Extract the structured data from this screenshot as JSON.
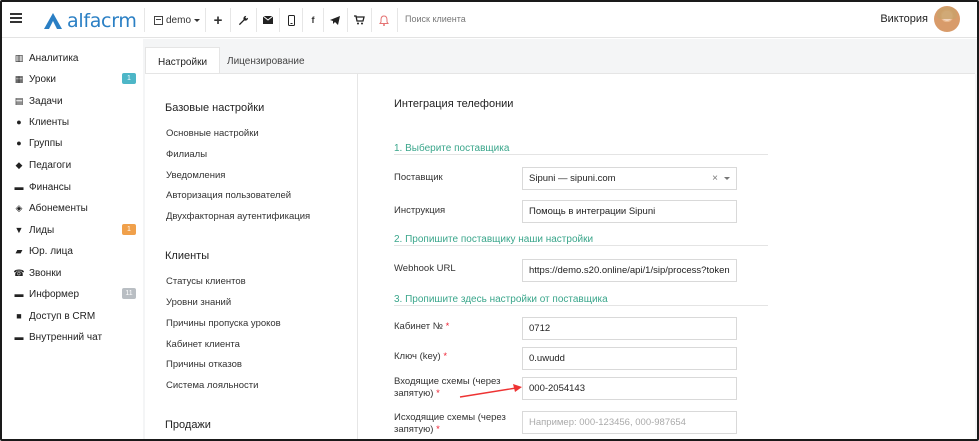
{
  "app": {
    "logo_text": "alfacrm",
    "branch": "demo",
    "search_placeholder": "Поиск клиента",
    "user_name": "Виктория"
  },
  "colors": {
    "accent": "#2a7fc4",
    "green": "#3aa68b",
    "badge_teal": "#4db6c7",
    "badge_orange": "#f0a04b",
    "badge_grey": "#b9bec3",
    "bell": "#e57373"
  },
  "toolbar_icons": [
    "plus-icon",
    "wrench-icon",
    "mail-icon",
    "phone-icon",
    "facebook-icon",
    "telegram-icon",
    "cart-icon",
    "bell-icon"
  ],
  "sidebar": {
    "items": [
      {
        "label": "Аналитика",
        "icon": "analytics-icon",
        "glyph": "▥"
      },
      {
        "label": "Уроки",
        "icon": "calendar-icon",
        "glyph": "▦",
        "badge": "1",
        "badge_color": "teal"
      },
      {
        "label": "Задачи",
        "icon": "tasks-icon",
        "glyph": "▤"
      },
      {
        "label": "Клиенты",
        "icon": "user-icon",
        "glyph": "●"
      },
      {
        "label": "Группы",
        "icon": "users-icon",
        "glyph": "●"
      },
      {
        "label": "Педагоги",
        "icon": "graduation-cap-icon",
        "glyph": "◆"
      },
      {
        "label": "Финансы",
        "icon": "money-icon",
        "glyph": "▬"
      },
      {
        "label": "Абонементы",
        "icon": "tag-icon",
        "glyph": "◈"
      },
      {
        "label": "Лиды",
        "icon": "funnel-icon",
        "glyph": "▼",
        "badge": "1",
        "badge_color": "orange"
      },
      {
        "label": "Юр. лица",
        "icon": "briefcase-icon",
        "glyph": "▰"
      },
      {
        "label": "Звонки",
        "icon": "phone-icon",
        "glyph": "☎"
      },
      {
        "label": "Информер",
        "icon": "informer-icon",
        "glyph": "▬",
        "badge": "11",
        "badge_color": "grey"
      },
      {
        "label": "Доступ в CRM",
        "icon": "lock-icon",
        "glyph": "■"
      },
      {
        "label": "Внутренний чат",
        "icon": "chat-icon",
        "glyph": "▬"
      }
    ]
  },
  "tabs": [
    {
      "label": "Настройки",
      "active": true
    },
    {
      "label": "Лицензирование",
      "active": false
    }
  ],
  "settings_menu": {
    "sections": [
      {
        "title": "Базовые настройки",
        "links": [
          "Основные настройки",
          "Филиалы",
          "Уведомления",
          "Авторизация пользователей",
          "Двухфакторная аутентификация"
        ]
      },
      {
        "title": "Клиенты",
        "links": [
          "Статусы клиентов",
          "Уровни знаний",
          "Причины пропуска уроков",
          "Кабинет клиента",
          "Причины отказов",
          "Система лояльности"
        ]
      },
      {
        "title": "Продажи",
        "links": []
      }
    ]
  },
  "telephony": {
    "title": "Интеграция телефонии",
    "step1": "1. Выберите поставщика",
    "step2": "2. Пропишите поставщику наши настройки",
    "step3": "3. Пропишите здесь настройки от поставщика",
    "fields": {
      "provider": {
        "label": "Поставщик",
        "value": "Sipuni — sipuni.com",
        "clear": "×"
      },
      "instruction": {
        "label": "Инструкция",
        "value": "Помощь в интеграции Sipuni"
      },
      "webhook": {
        "label": "Webhook URL",
        "value": "https://demo.s20.online/api/1/sip/process?token"
      },
      "cabinet": {
        "label": "Кабинет №",
        "required": "*",
        "value": "0712"
      },
      "key": {
        "label": "Ключ (key)",
        "required": "*",
        "value": "0.uwudd"
      },
      "incoming": {
        "label_line1": "Входящие схемы (через",
        "label_line2": "запятую)",
        "required": "*",
        "value": "000-2054143"
      },
      "outgoing": {
        "label_line1": "Исходящие схемы (через",
        "label_line2": "запятую)",
        "required": "*",
        "placeholder": "Например: 000-123456, 000-987654"
      }
    }
  }
}
